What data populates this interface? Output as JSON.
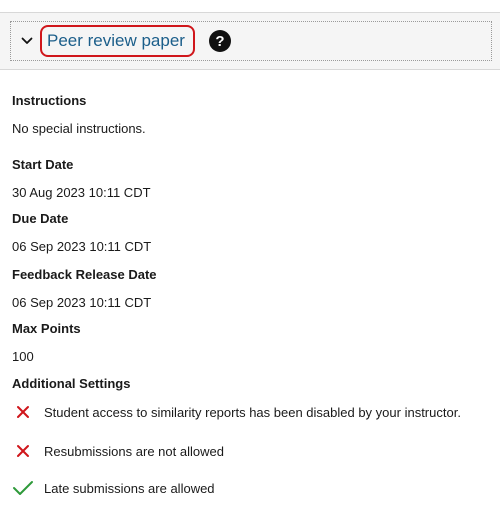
{
  "header": {
    "title": "Peer review paper",
    "help_symbol": "?",
    "chevron_icon": "chevron-down-icon",
    "help_icon": "question-circle-icon",
    "highlight_color": "#d0161b",
    "link_color": "#1b5e8a"
  },
  "details": [
    {
      "label": "Instructions",
      "value": "No special instructions."
    },
    {
      "label": "Start Date",
      "value": "30 Aug 2023 10:11 CDT"
    },
    {
      "label": "Due Date",
      "value": "06 Sep 2023 10:11 CDT"
    },
    {
      "label": "Feedback Release Date",
      "value": "06 Sep 2023 10:11 CDT"
    },
    {
      "label": "Max Points",
      "value": "100"
    }
  ],
  "additional_settings": {
    "label": "Additional Settings",
    "items": [
      {
        "icon": "x-icon",
        "status": "disabled",
        "color": "#d0161b",
        "text": "Student access to similarity reports has been disabled by your instructor."
      },
      {
        "icon": "x-icon",
        "status": "disabled",
        "color": "#d0161b",
        "text": "Resubmissions are not allowed"
      },
      {
        "icon": "check-icon",
        "status": "enabled",
        "color": "#2e9a3a",
        "text": "Late submissions are allowed"
      }
    ]
  }
}
